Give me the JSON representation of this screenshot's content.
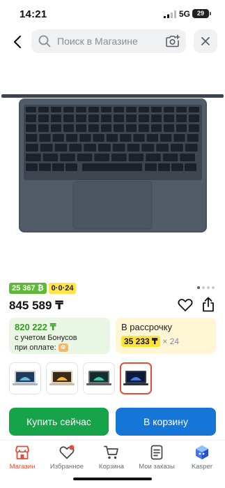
{
  "status_bar": {
    "time": "14:21",
    "network": "5G",
    "battery": "29"
  },
  "search": {
    "placeholder": "Поиск в Магазине"
  },
  "badges": {
    "bonus": "25 367 ₿",
    "installment": "0·0·24"
  },
  "product": {
    "price": "845 589 ₸"
  },
  "bonus_card": {
    "price": "820 222 ₸",
    "line1": "с учетом Бонусов",
    "line2": "при оплате:"
  },
  "installment_card": {
    "label": "В рассрочку",
    "amount": "35 233 ₸",
    "months": "× 24"
  },
  "gallery": {
    "count": 4,
    "active": 0
  },
  "thumbnails": [
    {
      "name": "thumb-silver",
      "selected": false
    },
    {
      "name": "thumb-starlight",
      "selected": false
    },
    {
      "name": "thumb-space-gray",
      "selected": false
    },
    {
      "name": "thumb-midnight",
      "selected": true
    }
  ],
  "buttons": {
    "buy_now": "Купить сейчас",
    "add_to_cart": "В корзину"
  },
  "bottom_nav": {
    "items": [
      {
        "label": "Магазин",
        "icon": "shop-icon",
        "active": true
      },
      {
        "label": "Избранное",
        "icon": "heart-icon",
        "active": false
      },
      {
        "label": "Корзина",
        "icon": "cart-icon",
        "active": false
      },
      {
        "label": "Мои заказы",
        "icon": "orders-icon",
        "active": false
      },
      {
        "label": "Kasper",
        "icon": "kasper-icon",
        "active": false
      }
    ]
  },
  "colors": {
    "accent_red": "#e44d3a",
    "buy_green": "#16a34a",
    "cart_blue": "#1676d8",
    "bonus_green": "#5fb83a",
    "installment_yellow": "#ffe54a"
  }
}
